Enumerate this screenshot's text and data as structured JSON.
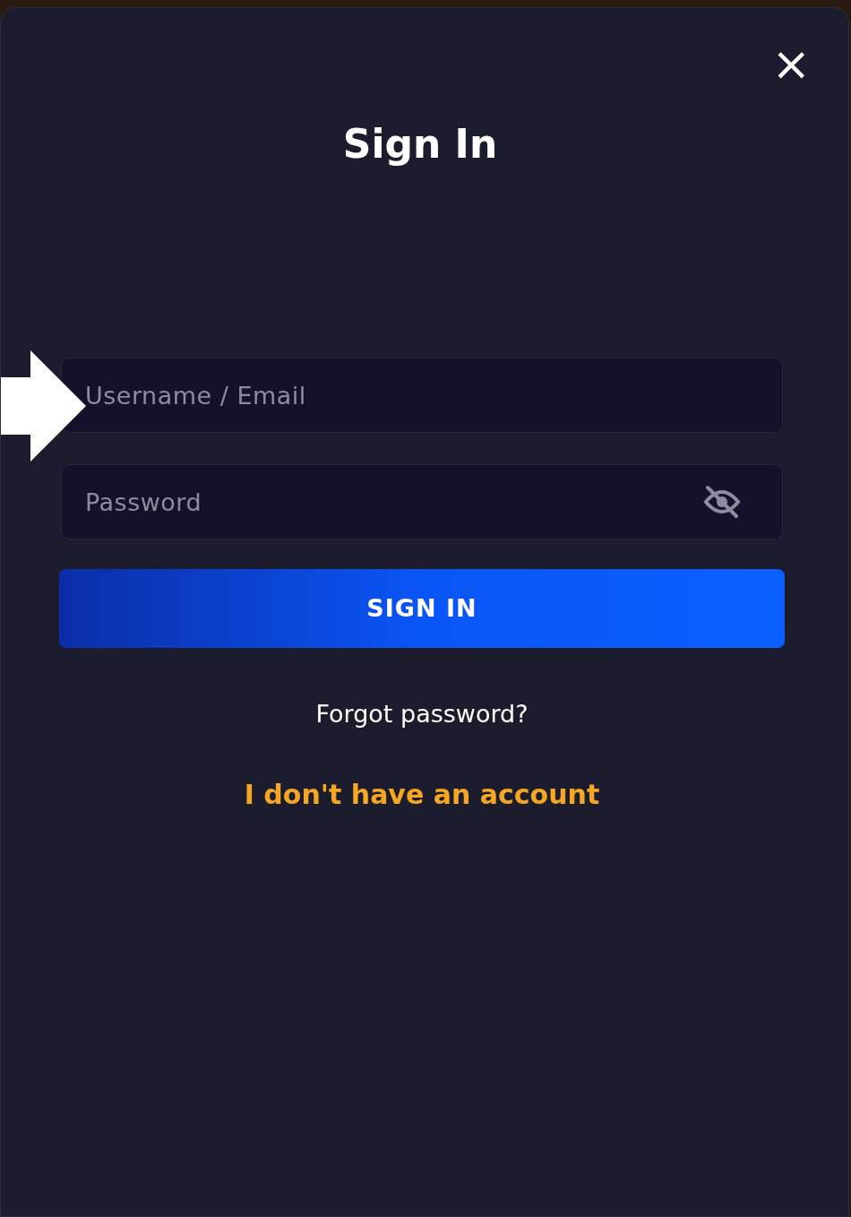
{
  "dialog": {
    "title": "Sign In",
    "close_label": "×"
  },
  "fields": [
    {
      "kind": "text",
      "placeholder": "Username / Email"
    },
    {
      "kind": "password",
      "placeholder": "Password"
    }
  ],
  "submit_button": "SIGN IN",
  "links": [
    {
      "kind": "plain",
      "label": "Forgot password?"
    },
    {
      "kind": "accent",
      "label": "I don't have an account"
    }
  ]
}
